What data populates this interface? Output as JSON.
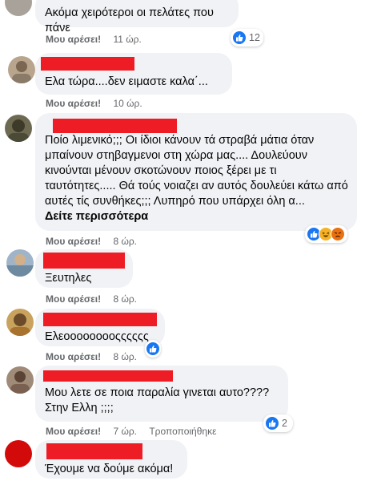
{
  "colors": {
    "bubble": "#f0f2f5",
    "redaction": "#ee1c25",
    "like_blue": "#1877f2",
    "love_red": "#f33e58",
    "haha_yellow": "#f7b125",
    "angry_orange": "#e9710f",
    "meta_gray": "#65676b"
  },
  "comments": [
    {
      "text": "Ακόμα χειρότεροι οι πελάτες που πάνε",
      "like_label": "Μου αρέσει!",
      "time": "11 ώρ.",
      "reactions": {
        "icons": [
          "like-icon"
        ],
        "count": "12"
      }
    },
    {
      "text": "Ελα τώρα....δεν ειμαστε καλα΄...",
      "like_label": "Μου αρέσει!",
      "time": "10 ώρ."
    },
    {
      "text": "Ποίο λιμενικό;;; Οι ίδιοι κάνουν τά στραβά μάτια όταν μπαίνουν στηβαγμενοι στη χώρα μας.... Δουλεύουν κινούνται μένουν σκοτώνουν ποιος ξέρει με τι ταυτότητες..... Θά τούς νοιαζει αν αυτός δουλεύει κάτω από αυτές τίς συνθήκες;;; Λυπηρό που υπάρχει όλη α...",
      "see_more": "Δείτε περισσότερα",
      "like_label": "Μου αρέσει!",
      "time": "8 ώρ.",
      "reactions": {
        "icons": [
          "like-icon",
          "haha-icon",
          "angry-icon"
        ],
        "count": ""
      }
    },
    {
      "text": "Ξευτηλες",
      "like_label": "Μου αρέσει!",
      "time": "8 ώρ."
    },
    {
      "text": "Ελεοοοοοοοοςςςςςς",
      "like_label": "Μου αρέσει!",
      "time": "8 ώρ.",
      "reactions": {
        "icons": [
          "like-icon"
        ],
        "count": ""
      }
    },
    {
      "text": "Μου λετε σε ποια παραλία γινεται αυτο????\nΣτην Ελλη ;;;;",
      "like_label": "Μου αρέσει!",
      "time": "7 ώρ.",
      "edited": "Τροποποιήθηκε",
      "reactions": {
        "icons": [
          "like-icon"
        ],
        "count": "2"
      }
    },
    {
      "text": "Έχουμε να δούμε ακόμα!"
    }
  ]
}
